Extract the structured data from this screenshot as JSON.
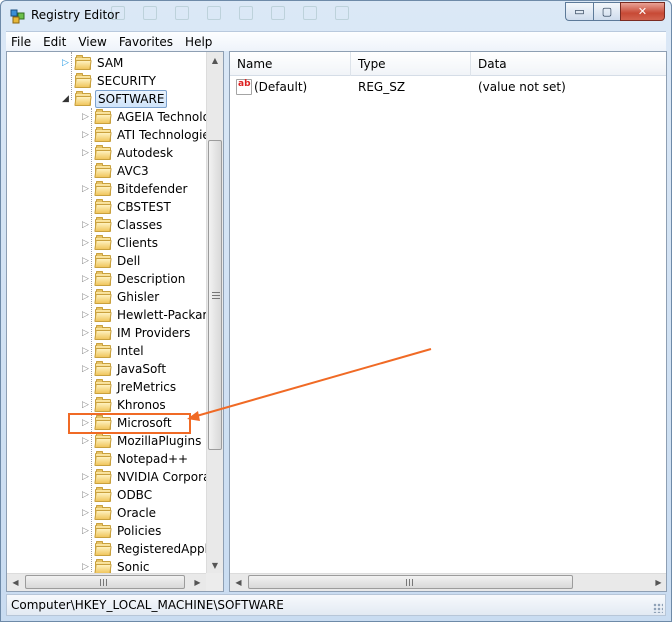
{
  "window": {
    "title": "Registry Editor",
    "controls": {
      "minimize": "▭",
      "maximize": "▢",
      "close": "✕"
    }
  },
  "menu": [
    "File",
    "Edit",
    "View",
    "Favorites",
    "Help"
  ],
  "tree": {
    "top_nodes": [
      {
        "label": "SAM",
        "arrow": "▷"
      },
      {
        "label": "SECURITY",
        "arrow": ""
      },
      {
        "label": "SOFTWARE",
        "arrow": "◢",
        "selected": true
      }
    ],
    "children": [
      {
        "label": "AGEIA Technologi",
        "arrow": "▷"
      },
      {
        "label": "ATI Technologies",
        "arrow": "▷"
      },
      {
        "label": "Autodesk",
        "arrow": "▷"
      },
      {
        "label": "AVC3",
        "arrow": ""
      },
      {
        "label": "Bitdefender",
        "arrow": "▷"
      },
      {
        "label": "CBSTEST",
        "arrow": ""
      },
      {
        "label": "Classes",
        "arrow": "▷"
      },
      {
        "label": "Clients",
        "arrow": "▷"
      },
      {
        "label": "Dell",
        "arrow": "▷"
      },
      {
        "label": "Description",
        "arrow": "▷"
      },
      {
        "label": "Ghisler",
        "arrow": "▷"
      },
      {
        "label": "Hewlett-Packard",
        "arrow": "▷"
      },
      {
        "label": "IM Providers",
        "arrow": "▷"
      },
      {
        "label": "Intel",
        "arrow": "▷"
      },
      {
        "label": "JavaSoft",
        "arrow": "▷"
      },
      {
        "label": "JreMetrics",
        "arrow": ""
      },
      {
        "label": "Khronos",
        "arrow": "▷"
      },
      {
        "label": "Microsoft",
        "arrow": "▷",
        "highlighted": true
      },
      {
        "label": "MozillaPlugins",
        "arrow": "▷"
      },
      {
        "label": "Notepad++",
        "arrow": ""
      },
      {
        "label": "NVIDIA Corporatic",
        "arrow": "▷"
      },
      {
        "label": "ODBC",
        "arrow": "▷"
      },
      {
        "label": "Oracle",
        "arrow": "▷"
      },
      {
        "label": "Policies",
        "arrow": "▷"
      },
      {
        "label": "RegisteredApplica",
        "arrow": ""
      },
      {
        "label": "Sonic",
        "arrow": "▷"
      }
    ]
  },
  "values": {
    "columns": [
      "Name",
      "Type",
      "Data"
    ],
    "rows": [
      {
        "name": "(Default)",
        "type": "REG_SZ",
        "data": "(value not set)",
        "icon": "ab"
      }
    ]
  },
  "status": {
    "path": "Computer\\HKEY_LOCAL_MACHINE\\SOFTWARE"
  },
  "colors": {
    "annotation": "#f06a25",
    "selection_border": "#7da2ce"
  }
}
